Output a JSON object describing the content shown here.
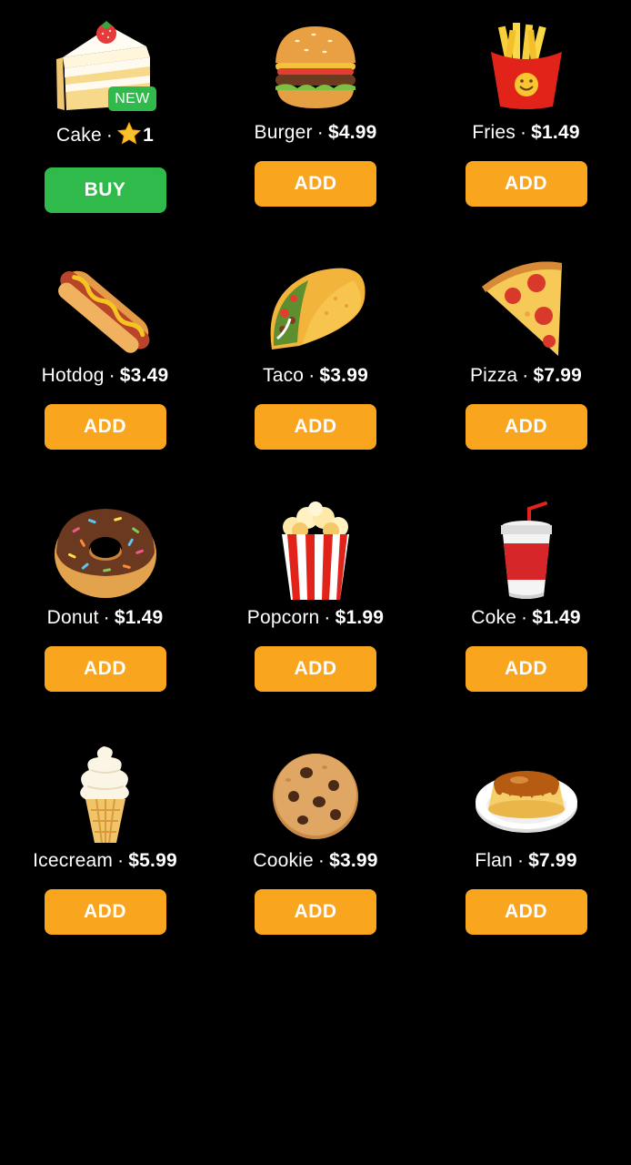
{
  "items": [
    {
      "name": "Cake",
      "price": "1",
      "price_type": "stars",
      "button": "BUY",
      "badge": "NEW",
      "icon": "cake-icon"
    },
    {
      "name": "Burger",
      "price": "$4.99",
      "button": "ADD",
      "icon": "burger-icon"
    },
    {
      "name": "Fries",
      "price": "$1.49",
      "button": "ADD",
      "icon": "fries-icon"
    },
    {
      "name": "Hotdog",
      "price": "$3.49",
      "button": "ADD",
      "icon": "hotdog-icon"
    },
    {
      "name": "Taco",
      "price": "$3.99",
      "button": "ADD",
      "icon": "taco-icon"
    },
    {
      "name": "Pizza",
      "price": "$7.99",
      "button": "ADD",
      "icon": "pizza-icon"
    },
    {
      "name": "Donut",
      "price": "$1.49",
      "button": "ADD",
      "icon": "donut-icon"
    },
    {
      "name": "Popcorn",
      "price": "$1.99",
      "button": "ADD",
      "icon": "popcorn-icon"
    },
    {
      "name": "Coke",
      "price": "$1.49",
      "button": "ADD",
      "icon": "coke-icon"
    },
    {
      "name": "Icecream",
      "price": "$5.99",
      "button": "ADD",
      "icon": "icecream-icon"
    },
    {
      "name": "Cookie",
      "price": "$3.99",
      "button": "ADD",
      "icon": "cookie-icon"
    },
    {
      "name": "Flan",
      "price": "$7.99",
      "button": "ADD",
      "icon": "flan-icon"
    }
  ],
  "separator": "·",
  "colors": {
    "background": "#000000",
    "add_button": "#f9a51d",
    "buy_button": "#2fba4b",
    "badge": "#2fba4b",
    "text": "#ffffff"
  }
}
